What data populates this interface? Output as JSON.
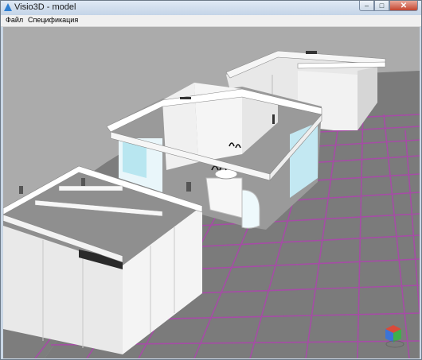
{
  "window": {
    "title": "Visio3D - model",
    "icon": "visio3d-app-icon",
    "controls": {
      "minimize": "–",
      "maximize": "□",
      "close": "✕"
    }
  },
  "menu": {
    "items": [
      {
        "label": "Файл"
      },
      {
        "label": "Спецификация"
      }
    ]
  },
  "viewport": {
    "scene": "3D exhibition stands model",
    "background_color": "#ababab",
    "floor_color": "#7b7b7b",
    "grid_line_color": "#a64ca6",
    "navigation_cube_icon": "view-cube-icon"
  }
}
